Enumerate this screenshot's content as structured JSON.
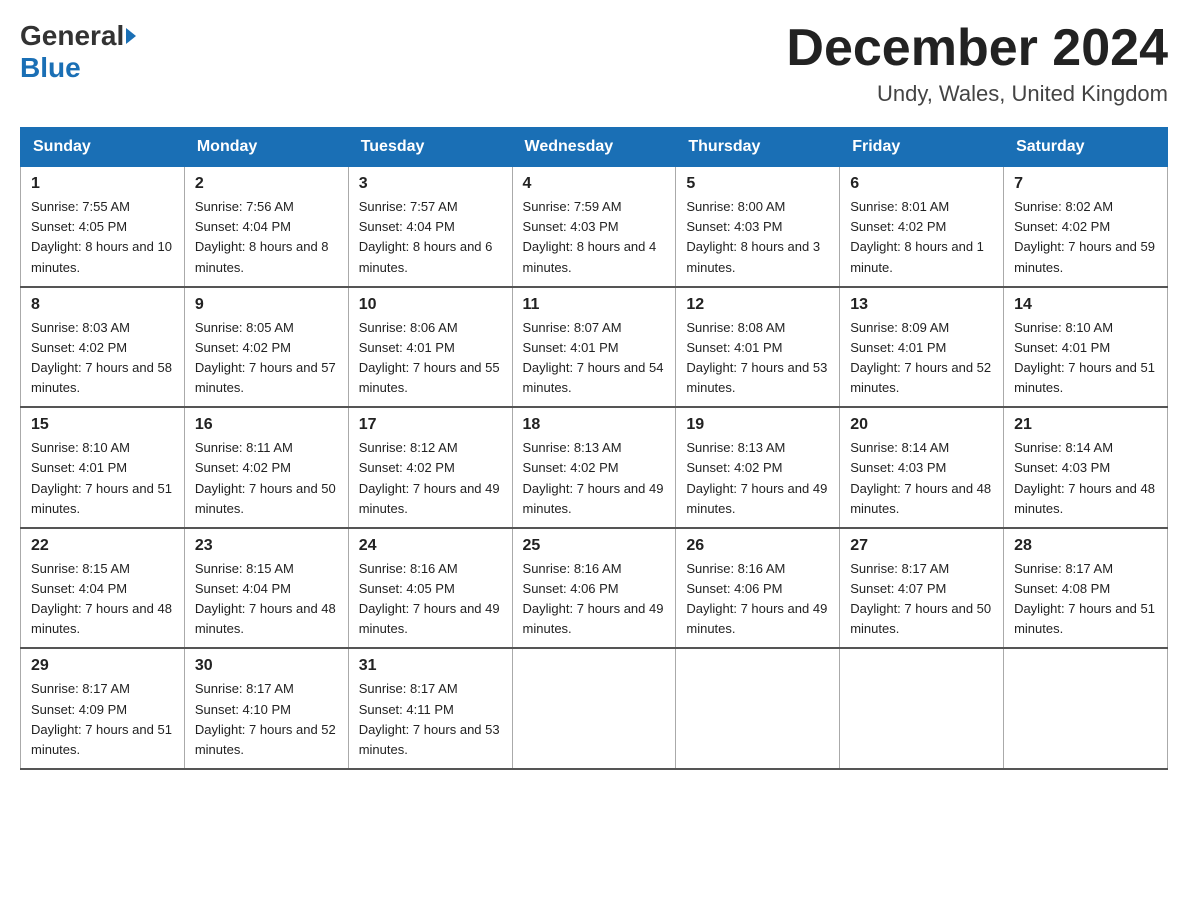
{
  "logo": {
    "general": "General",
    "blue": "Blue"
  },
  "title": "December 2024",
  "location": "Undy, Wales, United Kingdom",
  "days_header": [
    "Sunday",
    "Monday",
    "Tuesday",
    "Wednesday",
    "Thursday",
    "Friday",
    "Saturday"
  ],
  "weeks": [
    [
      {
        "day": "1",
        "sunrise": "7:55 AM",
        "sunset": "4:05 PM",
        "daylight": "8 hours and 10 minutes."
      },
      {
        "day": "2",
        "sunrise": "7:56 AM",
        "sunset": "4:04 PM",
        "daylight": "8 hours and 8 minutes."
      },
      {
        "day": "3",
        "sunrise": "7:57 AM",
        "sunset": "4:04 PM",
        "daylight": "8 hours and 6 minutes."
      },
      {
        "day": "4",
        "sunrise": "7:59 AM",
        "sunset": "4:03 PM",
        "daylight": "8 hours and 4 minutes."
      },
      {
        "day": "5",
        "sunrise": "8:00 AM",
        "sunset": "4:03 PM",
        "daylight": "8 hours and 3 minutes."
      },
      {
        "day": "6",
        "sunrise": "8:01 AM",
        "sunset": "4:02 PM",
        "daylight": "8 hours and 1 minute."
      },
      {
        "day": "7",
        "sunrise": "8:02 AM",
        "sunset": "4:02 PM",
        "daylight": "7 hours and 59 minutes."
      }
    ],
    [
      {
        "day": "8",
        "sunrise": "8:03 AM",
        "sunset": "4:02 PM",
        "daylight": "7 hours and 58 minutes."
      },
      {
        "day": "9",
        "sunrise": "8:05 AM",
        "sunset": "4:02 PM",
        "daylight": "7 hours and 57 minutes."
      },
      {
        "day": "10",
        "sunrise": "8:06 AM",
        "sunset": "4:01 PM",
        "daylight": "7 hours and 55 minutes."
      },
      {
        "day": "11",
        "sunrise": "8:07 AM",
        "sunset": "4:01 PM",
        "daylight": "7 hours and 54 minutes."
      },
      {
        "day": "12",
        "sunrise": "8:08 AM",
        "sunset": "4:01 PM",
        "daylight": "7 hours and 53 minutes."
      },
      {
        "day": "13",
        "sunrise": "8:09 AM",
        "sunset": "4:01 PM",
        "daylight": "7 hours and 52 minutes."
      },
      {
        "day": "14",
        "sunrise": "8:10 AM",
        "sunset": "4:01 PM",
        "daylight": "7 hours and 51 minutes."
      }
    ],
    [
      {
        "day": "15",
        "sunrise": "8:10 AM",
        "sunset": "4:01 PM",
        "daylight": "7 hours and 51 minutes."
      },
      {
        "day": "16",
        "sunrise": "8:11 AM",
        "sunset": "4:02 PM",
        "daylight": "7 hours and 50 minutes."
      },
      {
        "day": "17",
        "sunrise": "8:12 AM",
        "sunset": "4:02 PM",
        "daylight": "7 hours and 49 minutes."
      },
      {
        "day": "18",
        "sunrise": "8:13 AM",
        "sunset": "4:02 PM",
        "daylight": "7 hours and 49 minutes."
      },
      {
        "day": "19",
        "sunrise": "8:13 AM",
        "sunset": "4:02 PM",
        "daylight": "7 hours and 49 minutes."
      },
      {
        "day": "20",
        "sunrise": "8:14 AM",
        "sunset": "4:03 PM",
        "daylight": "7 hours and 48 minutes."
      },
      {
        "day": "21",
        "sunrise": "8:14 AM",
        "sunset": "4:03 PM",
        "daylight": "7 hours and 48 minutes."
      }
    ],
    [
      {
        "day": "22",
        "sunrise": "8:15 AM",
        "sunset": "4:04 PM",
        "daylight": "7 hours and 48 minutes."
      },
      {
        "day": "23",
        "sunrise": "8:15 AM",
        "sunset": "4:04 PM",
        "daylight": "7 hours and 48 minutes."
      },
      {
        "day": "24",
        "sunrise": "8:16 AM",
        "sunset": "4:05 PM",
        "daylight": "7 hours and 49 minutes."
      },
      {
        "day": "25",
        "sunrise": "8:16 AM",
        "sunset": "4:06 PM",
        "daylight": "7 hours and 49 minutes."
      },
      {
        "day": "26",
        "sunrise": "8:16 AM",
        "sunset": "4:06 PM",
        "daylight": "7 hours and 49 minutes."
      },
      {
        "day": "27",
        "sunrise": "8:17 AM",
        "sunset": "4:07 PM",
        "daylight": "7 hours and 50 minutes."
      },
      {
        "day": "28",
        "sunrise": "8:17 AM",
        "sunset": "4:08 PM",
        "daylight": "7 hours and 51 minutes."
      }
    ],
    [
      {
        "day": "29",
        "sunrise": "8:17 AM",
        "sunset": "4:09 PM",
        "daylight": "7 hours and 51 minutes."
      },
      {
        "day": "30",
        "sunrise": "8:17 AM",
        "sunset": "4:10 PM",
        "daylight": "7 hours and 52 minutes."
      },
      {
        "day": "31",
        "sunrise": "8:17 AM",
        "sunset": "4:11 PM",
        "daylight": "7 hours and 53 minutes."
      },
      null,
      null,
      null,
      null
    ]
  ]
}
